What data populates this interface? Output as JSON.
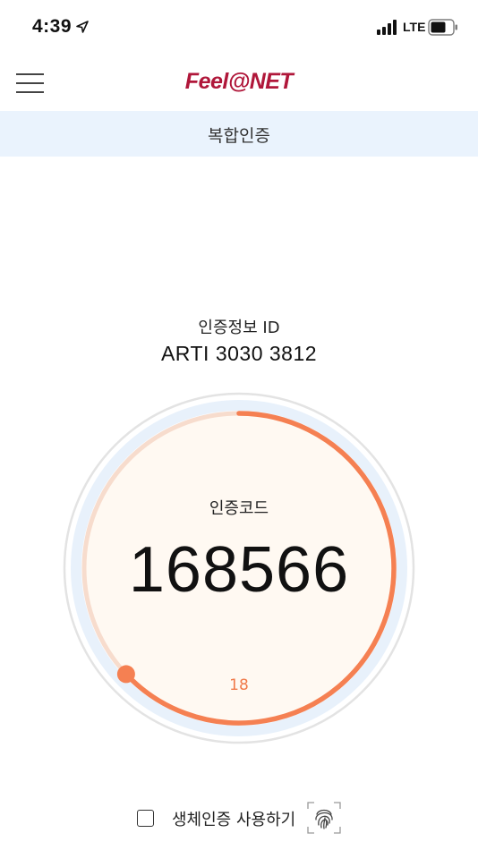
{
  "status_bar": {
    "time": "4:39",
    "network": "LTE",
    "icons": [
      "location-arrow-icon",
      "signal-bars-icon",
      "battery-icon"
    ]
  },
  "header": {
    "logo": "Feel@NET",
    "menu_icon": "hamburger-menu-icon"
  },
  "page": {
    "title": "복합인증"
  },
  "auth": {
    "id_label": "인증정보 ID",
    "id_value": "ARTI 3030 3812",
    "code_label": "인증코드",
    "code_value": "168566",
    "seconds_remaining": "18",
    "progress_remaining_fraction": 0.63
  },
  "biometric": {
    "checkbox_checked": false,
    "label": "생체인증 사용하기",
    "icon": "fingerprint-icon"
  },
  "colors": {
    "brand": "#b0173a",
    "accent": "#f58052",
    "title_bar_bg": "#eaf3fd",
    "timer_face": "#fff9f2"
  }
}
